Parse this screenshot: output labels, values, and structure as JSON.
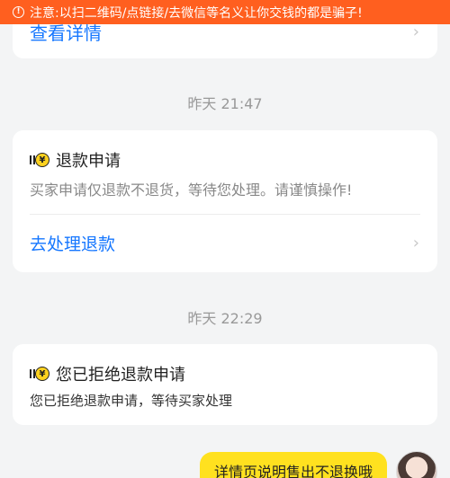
{
  "warning": {
    "text": "注意:以扫二维码/点链接/去微信等名义让你交钱的都是骗子!"
  },
  "top_card": {
    "link_label": "查看详情"
  },
  "messages": [
    {
      "time": "昨天 21:47",
      "title": "退款申请",
      "desc": "买家申请仅退款不退货，等待您处理。请谨慎操作!",
      "link_label": "去处理退款"
    },
    {
      "time": "昨天 22:29",
      "title": "您已拒绝退款申请",
      "desc": "您已拒绝退款申请，等待买家处理"
    }
  ],
  "outgoing_bubble": {
    "text": "详情页说明售出不退换哦"
  },
  "icons": {
    "warning": "info-circle-icon",
    "yen": "yen-coin-icon",
    "chevron": "chevron-right-icon",
    "avatar": "user-avatar"
  },
  "colors": {
    "warning_bar": "#ff5f1f",
    "link": "#1677ff",
    "bubble": "#ffe11f"
  }
}
